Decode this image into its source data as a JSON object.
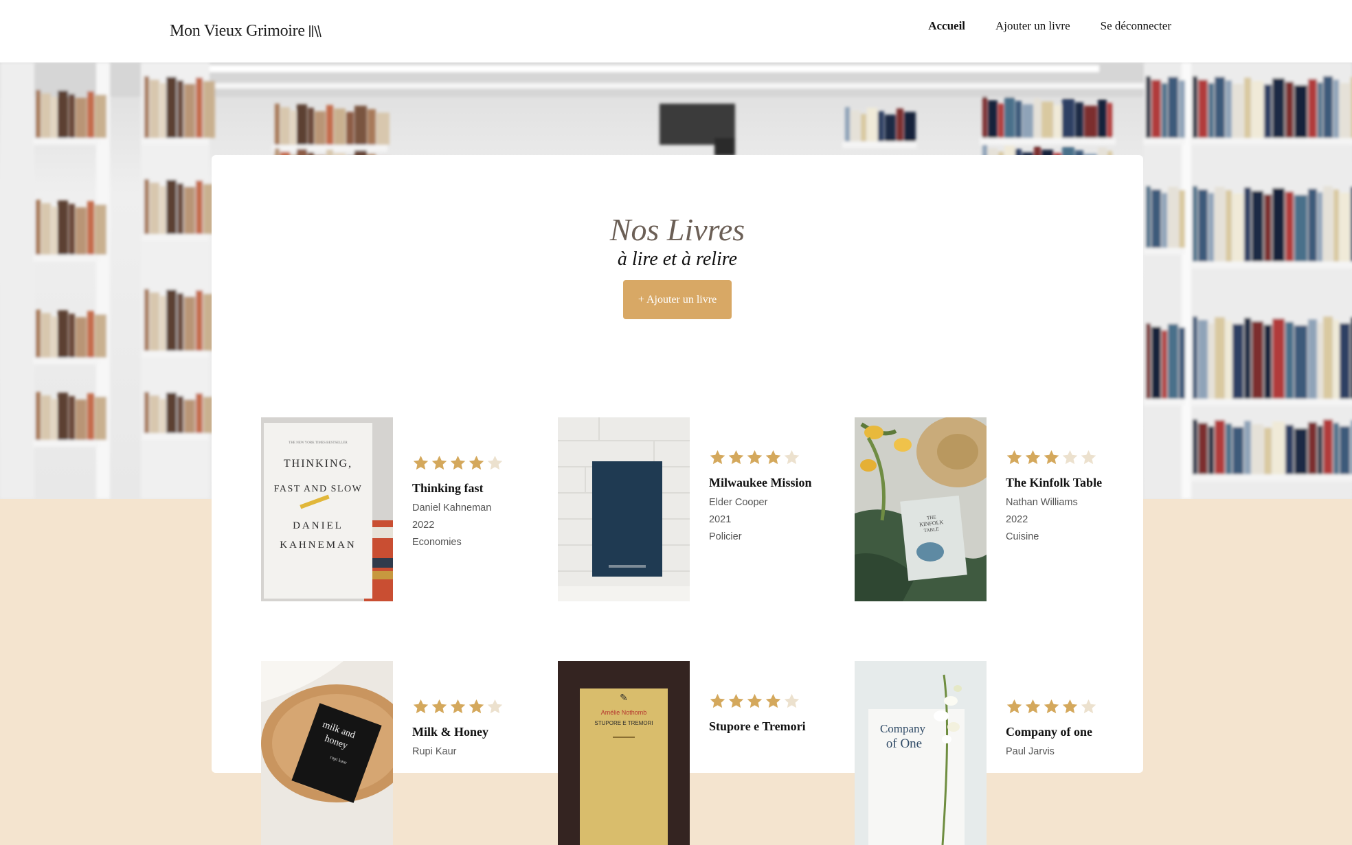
{
  "nav": {
    "logo_text": "Mon Vieux Grimoire",
    "links": [
      {
        "label": "Accueil",
        "active": true
      },
      {
        "label": "Ajouter un livre",
        "active": false
      },
      {
        "label": "Se déconnecter",
        "active": false
      }
    ]
  },
  "main": {
    "title": "Nos Livres",
    "subtitle": "à lire et à relire",
    "add_button": "+ Ajouter un livre"
  },
  "colors": {
    "accent": "#d8a865",
    "star_filled": "#d4a85c",
    "star_empty": "#ece1ce",
    "cream": "#f4e4cf"
  },
  "books": [
    {
      "title": "Thinking fast",
      "author": "Daniel Kahneman",
      "year": "2022",
      "genre": "Economies",
      "rating": 4,
      "cover": {
        "lines": [
          "THE NEW YORK TIMES BESTSELLER",
          "THINKING,",
          "FAST AND SLOW",
          "DANIEL",
          "KAHNEMAN"
        ]
      }
    },
    {
      "title": "Milwaukee Mission",
      "author": "Elder Cooper",
      "year": "2021",
      "genre": "Policier",
      "rating": 4,
      "cover": {}
    },
    {
      "title": "The Kinfolk Table",
      "author": "Nathan Williams",
      "year": "2022",
      "genre": "Cuisine",
      "rating": 3,
      "cover": {
        "lines": [
          "THE",
          "KINFOLK",
          "TABLE"
        ]
      }
    },
    {
      "title": "Milk & Honey",
      "author": "Rupi Kaur",
      "year": "",
      "genre": "",
      "rating": 4,
      "cover": {
        "lines": [
          "milk and",
          "honey",
          "rupi kaur"
        ]
      }
    },
    {
      "title": "Stupore e Tremori",
      "author": "",
      "year": "",
      "genre": "",
      "rating": 4,
      "cover": {
        "lines": [
          "Amélie Nothomb",
          "STUPORE E TREMORI"
        ]
      }
    },
    {
      "title": "Company of one",
      "author": "Paul Jarvis",
      "year": "",
      "genre": "",
      "rating": 4,
      "cover": {
        "lines": [
          "Company",
          "of One"
        ]
      }
    }
  ]
}
